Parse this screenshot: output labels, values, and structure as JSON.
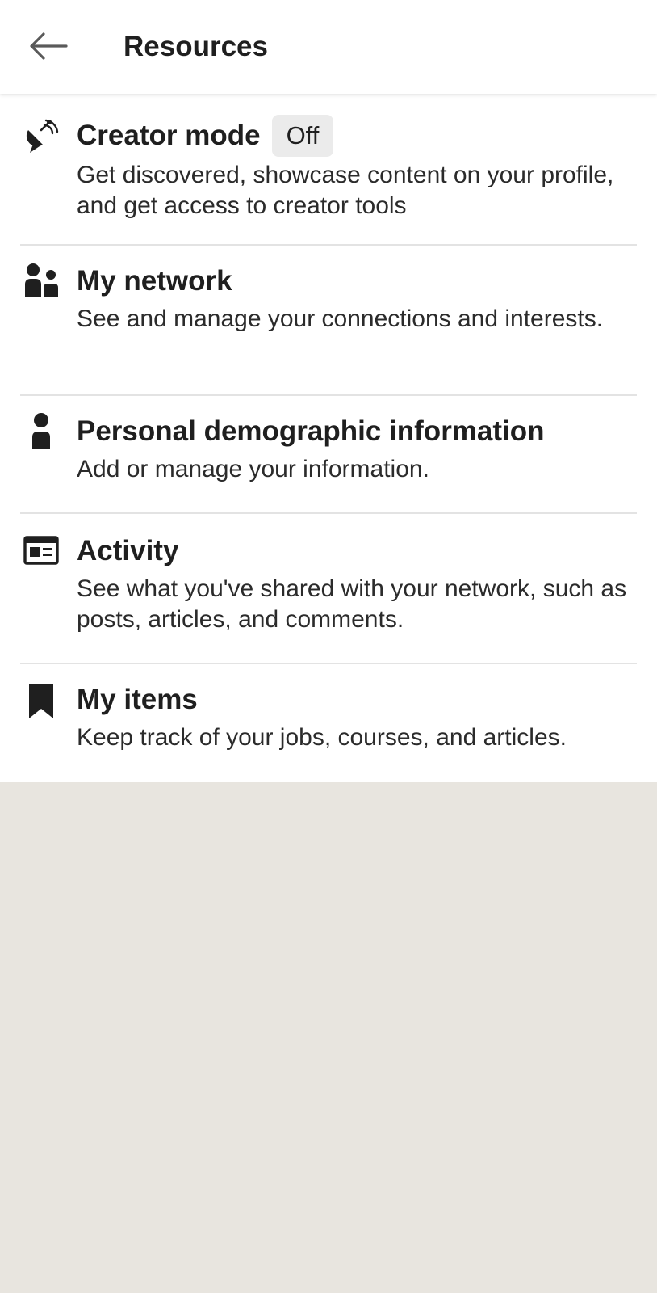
{
  "header": {
    "title": "Resources",
    "back_icon": "arrow-left-icon"
  },
  "items": [
    {
      "title": "Creator mode",
      "badge": "Off",
      "description": "Get discovered, showcase content on your profile, and get access to creator tools",
      "icon": "satellite-dish-icon"
    },
    {
      "title": "My network",
      "description": "See and manage your connections and interests.",
      "icon": "people-icon"
    },
    {
      "title": "Personal demographic information",
      "description": "Add or manage your information.",
      "icon": "person-icon"
    },
    {
      "title": "Activity",
      "description": "See what you've shared with your network, such as posts, articles, and comments.",
      "icon": "article-icon"
    },
    {
      "title": "My items",
      "description": "Keep track of your jobs, courses, and articles.",
      "icon": "bookmark-icon"
    }
  ],
  "colors": {
    "panel_bg": "#ffffff",
    "page_bg": "#e8e5df",
    "text": "#1f1f1f",
    "badge_bg": "#ebebeb",
    "divider": "#e3e3e3"
  }
}
